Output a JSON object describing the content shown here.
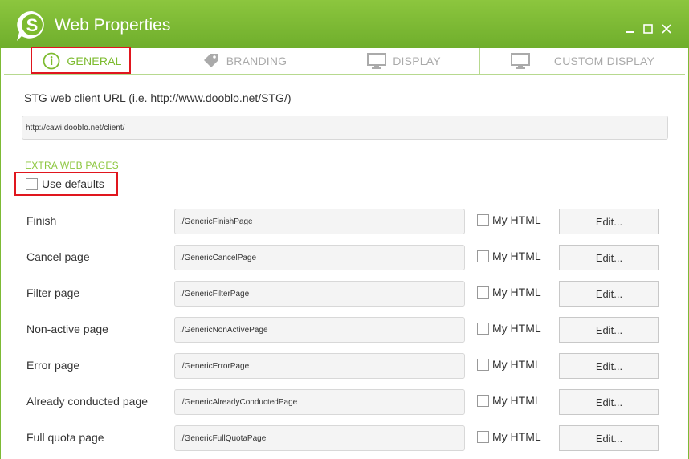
{
  "window": {
    "title": "Web Properties",
    "accent_color": "#8cc63e",
    "highlight_color": "#e0161e",
    "logo_icon": "dooblo-s-logo-icon",
    "controls": [
      "minimize-icon",
      "maximize-icon",
      "close-icon"
    ]
  },
  "tabs": [
    {
      "label": "GENERAL",
      "icon": "info-icon",
      "active": true
    },
    {
      "label": "BRANDING",
      "icon": "tag-icon",
      "active": false
    },
    {
      "label": "DISPLAY",
      "icon": "monitor-icon",
      "active": false
    },
    {
      "label": "CUSTOM DISPLAY",
      "icon": "monitor-icon",
      "active": false
    }
  ],
  "general": {
    "url_label": "STG web client URL (i.e. http://www.dooblo.net/STG/)",
    "url_value": "http://cawi.dooblo.net/client/",
    "section_heading": "EXTRA WEB PAGES",
    "use_defaults_label": "Use defaults",
    "use_defaults_checked": false,
    "pages": [
      {
        "label": "Finish",
        "value": "./GenericFinishPage",
        "my_html_label": "My HTML",
        "my_html_checked": false,
        "edit_label": "Edit..."
      },
      {
        "label": "Cancel page",
        "value": "./GenericCancelPage",
        "my_html_label": "My HTML",
        "my_html_checked": false,
        "edit_label": "Edit..."
      },
      {
        "label": "Filter page",
        "value": "./GenericFilterPage",
        "my_html_label": "My HTML",
        "my_html_checked": false,
        "edit_label": "Edit..."
      },
      {
        "label": "Non-active page",
        "value": "./GenericNonActivePage",
        "my_html_label": "My HTML",
        "my_html_checked": false,
        "edit_label": "Edit..."
      },
      {
        "label": "Error page",
        "value": "./GenericErrorPage",
        "my_html_label": "My HTML",
        "my_html_checked": false,
        "edit_label": "Edit..."
      },
      {
        "label": "Already conducted page",
        "value": "./GenericAlreadyConductedPage",
        "my_html_label": "My HTML",
        "my_html_checked": false,
        "edit_label": "Edit..."
      },
      {
        "label": "Full quota page",
        "value": "./GenericFullQuotaPage",
        "my_html_label": "My HTML",
        "my_html_checked": false,
        "edit_label": "Edit..."
      }
    ]
  }
}
